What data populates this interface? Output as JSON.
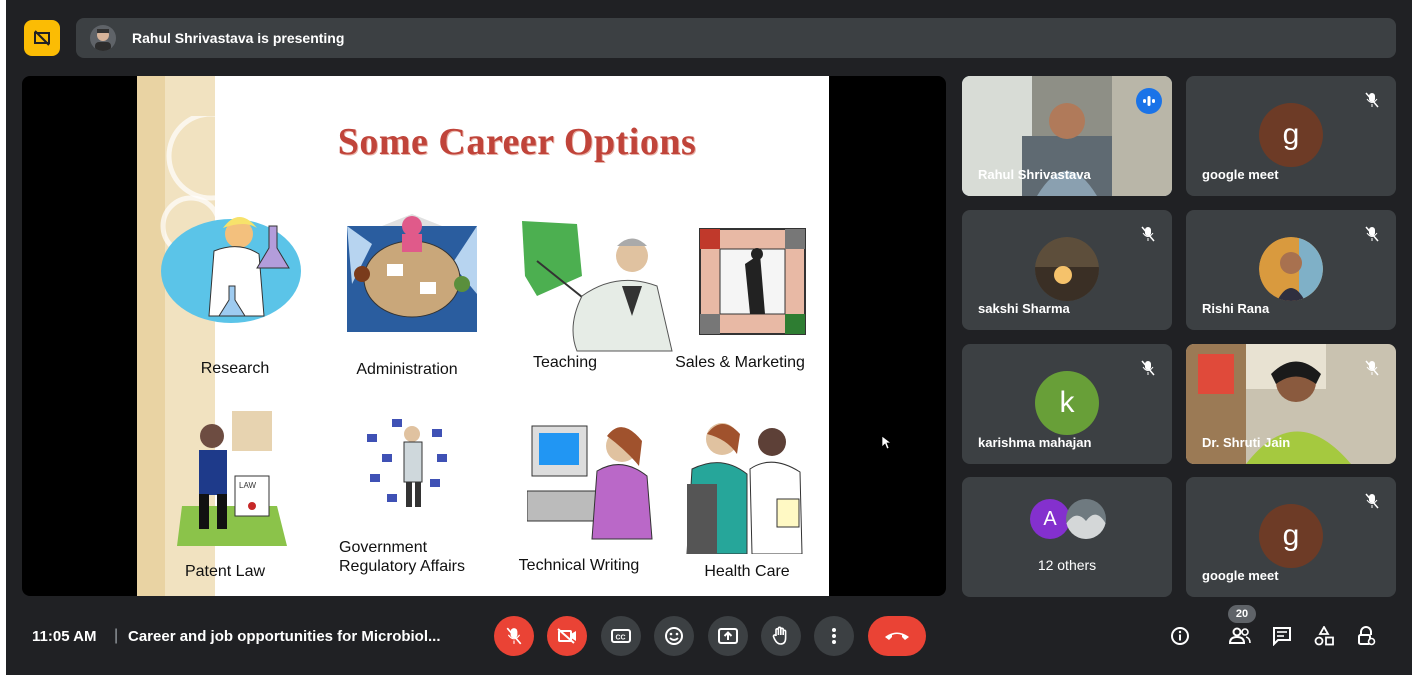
{
  "presenter_bar": {
    "text": "Rahul Shrivastava is presenting"
  },
  "slide": {
    "title": "Some Career Options",
    "items": [
      {
        "label": "Research",
        "icon": "scientist-clipart"
      },
      {
        "label": "Administration",
        "icon": "meeting-table-clipart"
      },
      {
        "label": "Teaching",
        "icon": "teacher-clipart"
      },
      {
        "label": "Sales & Marketing",
        "icon": "sales-chart-clipart"
      },
      {
        "label": "Patent Law",
        "icon": "lawyer-clipart"
      },
      {
        "label_line1": "Government",
        "label_line2": "Regulatory Affairs",
        "icon": "regulatory-clipart"
      },
      {
        "label": "Technical Writing",
        "icon": "computer-writer-clipart"
      },
      {
        "label": "Health Care",
        "icon": "doctors-clipart"
      }
    ]
  },
  "participants": [
    {
      "name": "Rahul Shrivastava",
      "type": "video",
      "speaking": true
    },
    {
      "name": "google meet",
      "type": "avatar",
      "letter": "g",
      "color": "#6d3b26",
      "muted": true
    },
    {
      "name": "sakshi Sharma",
      "type": "photo",
      "muted": true
    },
    {
      "name": "Rishi Rana",
      "type": "photo",
      "muted": true
    },
    {
      "name": "karishma mahajan",
      "type": "avatar",
      "letter": "k",
      "color": "#689f38",
      "muted": true
    },
    {
      "name": "Dr. Shruti Jain",
      "type": "video",
      "muted": true
    },
    {
      "name": "12 others",
      "type": "group",
      "letter": "A",
      "color": "#8430ce"
    },
    {
      "name": "google meet",
      "type": "avatar",
      "letter": "g",
      "color": "#6d3b26",
      "muted": true
    }
  ],
  "bottom_bar": {
    "time": "11:05 AM",
    "separator": "|",
    "meeting_title": "Career and job opportunities for Microbiol...",
    "participant_count": "20"
  },
  "colors": {
    "background": "#202124",
    "tile": "#3c4043",
    "danger": "#ea4335",
    "accent": "#fbbc04",
    "speaking": "#8ab4f8"
  }
}
